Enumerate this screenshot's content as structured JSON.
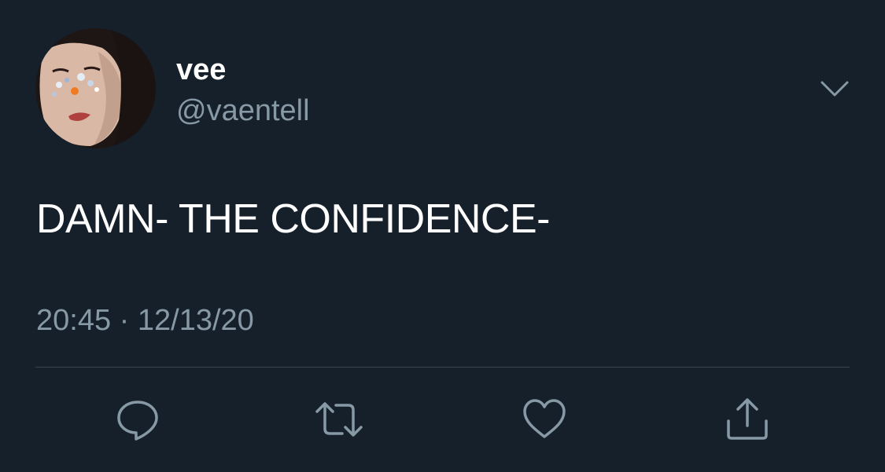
{
  "user": {
    "display_name": "vee",
    "handle": "@vaentell"
  },
  "tweet": {
    "text": "DAMN- THE CONFIDENCE-",
    "time": "20:45",
    "separator": "·",
    "date": "12/13/20"
  },
  "icons": {
    "avatar": "user-avatar",
    "more": "chevron-down-icon",
    "reply": "reply-icon",
    "retweet": "retweet-icon",
    "like": "heart-icon",
    "share": "share-icon"
  },
  "colors": {
    "background": "#15202b",
    "primary_text": "#ffffff",
    "secondary_text": "#8899a6",
    "divider": "#38444d"
  }
}
